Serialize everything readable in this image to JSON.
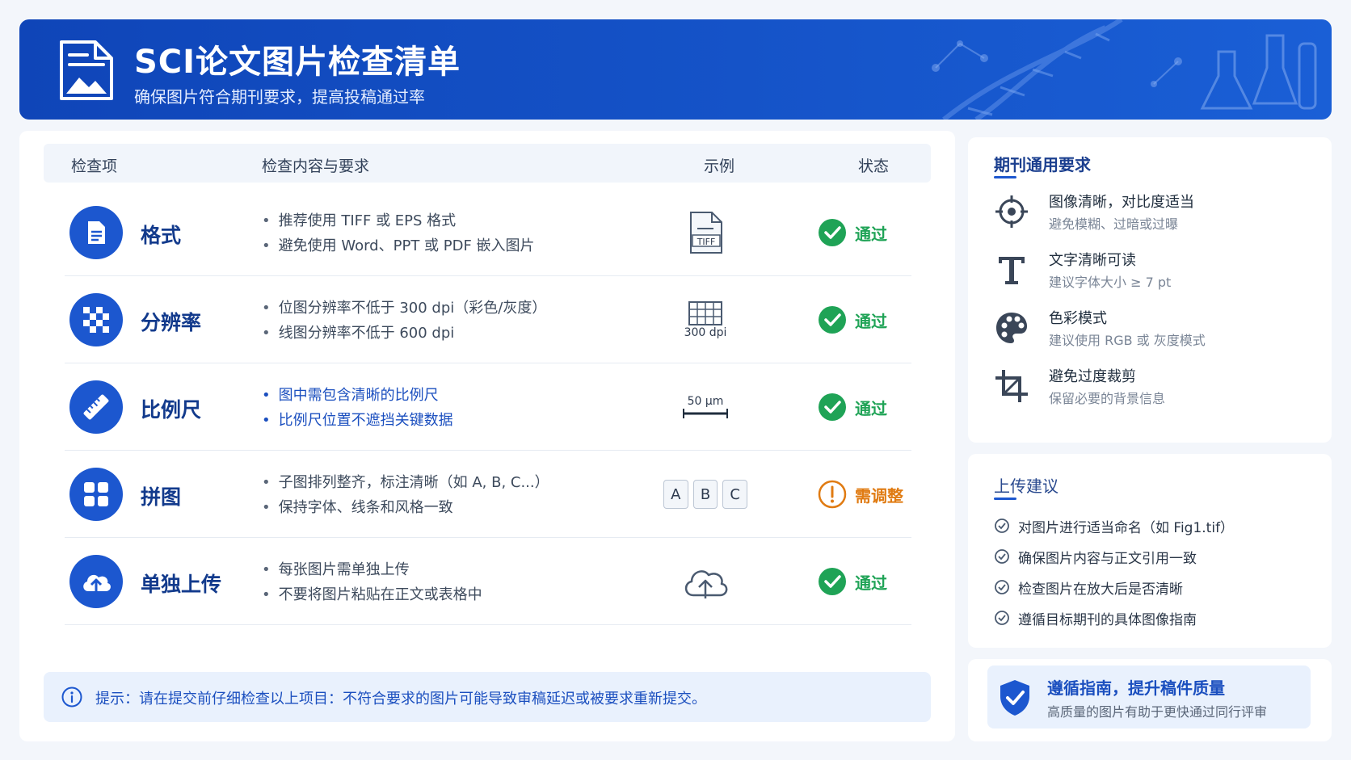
{
  "header": {
    "title": "SCI论文图片检查清单",
    "subtitle": "确保图片符合期刊要求，提高投稿通过率"
  },
  "table": {
    "columns": [
      "检查项",
      "检查内容与要求",
      "示例",
      "状态"
    ],
    "rows": [
      {
        "icon": "document-icon",
        "name": "格式",
        "bullets": [
          "推荐使用 TIFF 或 EPS 格式",
          "避免使用 Word、PPT 或 PDF 嵌入图片"
        ],
        "example_icon": "tiff-file-icon",
        "example_label": "TIFF",
        "status": "通过",
        "status_type": "pass"
      },
      {
        "icon": "checkerboard-icon",
        "name": "分辨率",
        "bullets": [
          "位图分辨率不低于 300 dpi（彩色/灰度）",
          "线图分辨率不低于 600 dpi"
        ],
        "example_icon": "grid-icon",
        "example_label": "300 dpi",
        "status": "通过",
        "status_type": "pass"
      },
      {
        "icon": "ruler-icon",
        "name": "比例尺",
        "bullets": [
          "图中需包含清晰的比例尺",
          "比例尺位置不遮挡关键数据"
        ],
        "example_icon": "scale-bar-icon",
        "example_label": "50 μm",
        "status": "通过",
        "status_type": "pass"
      },
      {
        "icon": "four-squares-icon",
        "name": "拼图",
        "bullets": [
          "子图排列整齐，标注清晰（如 A, B, C...）",
          "保持字体、线条和风格一致"
        ],
        "example_icon": "panel-labels",
        "example_labels": [
          "A",
          "B",
          "C"
        ],
        "status": "需调整",
        "status_type": "warn"
      },
      {
        "icon": "cloud-upload-icon",
        "name": "单独上传",
        "bullets": [
          "每张图片需单独上传",
          "不要将图片粘贴在正文或表格中"
        ],
        "example_icon": "cloud-upload-outline-icon",
        "status": "通过",
        "status_type": "pass"
      }
    ]
  },
  "tip": {
    "text": "提示：请在提交前仔细检查以上项目：不符合要求的图片可能导致审稿延迟或被要求重新提交。"
  },
  "requirements": {
    "heading": "期刊通用要求",
    "items": [
      {
        "icon": "crosshair-icon",
        "title": "图像清晰，对比度适当",
        "desc": "避免模糊、过暗或过曝"
      },
      {
        "icon": "text-t-icon",
        "title": "文字清晰可读",
        "desc": "建议字体大小 ≥ 7 pt"
      },
      {
        "icon": "palette-icon",
        "title": "色彩模式",
        "desc": "建议使用 RGB 或 灰度模式"
      },
      {
        "icon": "crop-icon",
        "title": "避免过度裁剪",
        "desc": "保留必要的背景信息"
      }
    ]
  },
  "upload": {
    "heading": "上传建议",
    "items": [
      "对图片进行适当命名（如 Fig1.tif）",
      "确保图片内容与正文引用一致",
      "检查图片在放大后是否清晰",
      "遵循目标期刊的具体图像指南"
    ]
  },
  "quality": {
    "title": "遵循指南，提升稿件质量",
    "desc": "高质量的图片有助于更快通过同行评审"
  },
  "colors": {
    "primary": "#1c57cf",
    "header": "#0f45b8",
    "pass": "#1fa356",
    "warn": "#e07b12"
  }
}
